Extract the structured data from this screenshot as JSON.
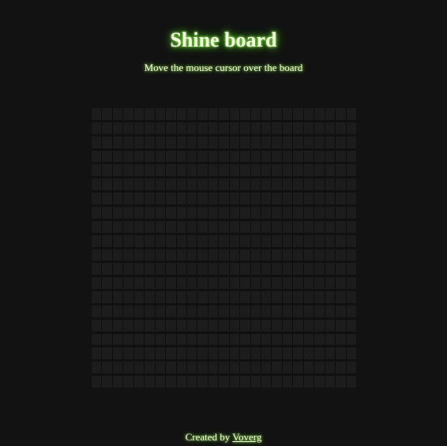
{
  "header": {
    "title": "Shine board",
    "subtitle": "Move the mouse cursor over the board"
  },
  "board": {
    "rows": 20,
    "columns": 25,
    "cell_color": "#1c1c1c",
    "glow_color": "#5fd62a"
  },
  "footer": {
    "prefix": "Created by ",
    "author": "Voverg"
  },
  "colors": {
    "background": "#121212",
    "text": "#fffbe8",
    "accent_glow": "#5fd62a"
  }
}
